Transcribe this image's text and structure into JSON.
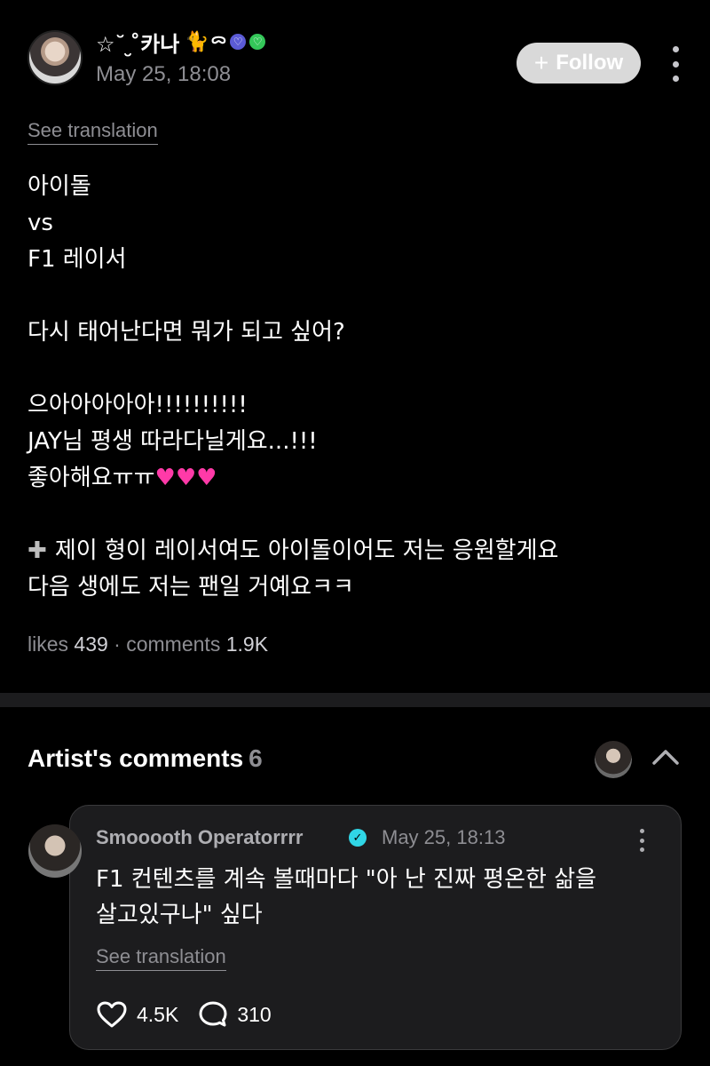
{
  "post": {
    "username": "☆˘ ̮ ̊카나",
    "cat_emoji": "🐈",
    "ribbon": "ᯅ",
    "timestamp": "May 25, 18:08",
    "follow_label": "Follow",
    "see_translation": "See translation",
    "body_lines": [
      "아이돌",
      "vs",
      "F1 레이서",
      "",
      "다시 태어난다면 뭐가 되고 싶어?",
      "",
      "으아아아아아!!!!!!!!!!",
      "JAY님 평생 따라다닐게요...!!!",
      "좋아해요ㅠㅠ",
      "",
      "제이 형이 레이서여도 아이돌이어도 저는 응원할게요",
      "다음 생에도 저는 팬일 거예요ㅋㅋ"
    ],
    "likes_label": "likes",
    "likes_value": "439",
    "comments_label": "comments",
    "comments_value": "1.9K",
    "separator": "·"
  },
  "artist_comments": {
    "title": "Artist's comments",
    "count": "6"
  },
  "comment": {
    "author": "Smooooth Operatorrrr",
    "timestamp": "May 25, 18:13",
    "text_line1": "F1 컨텐츠를 계속 볼때마다 \"아 난 진짜 평온한 삶을",
    "text_line2": "살고있구나\" 싶다",
    "see_translation": "See translation",
    "likes": "4.5K",
    "replies": "310"
  },
  "colors": {
    "background": "#000000",
    "card": "#1c1c1e",
    "muted": "#8e8e93",
    "heart": "#ff3aa8",
    "verified": "#30d6e6"
  },
  "icons": [
    "kebab-icon",
    "plus-icon",
    "heart-icon",
    "reply-icon",
    "chevron-up-icon",
    "verified-icon"
  ]
}
